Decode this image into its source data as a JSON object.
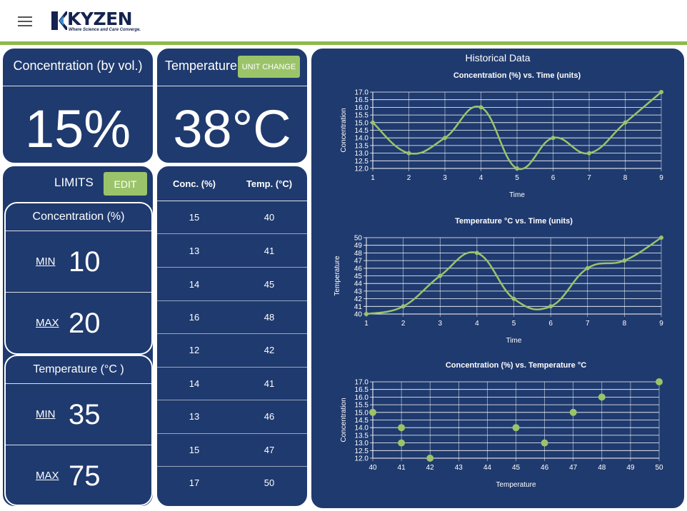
{
  "header": {
    "menu_icon": "hamburger-menu-icon",
    "logo_text": "KYZEN",
    "logo_tagline": "Where Science and Care Converge.",
    "accent_color": "#8db94a"
  },
  "concentration_card": {
    "title": "Concentration (by vol.)",
    "value": "15%"
  },
  "temperature_card": {
    "title": "Temperature",
    "unit_button": "UNIT CHANGE",
    "value": "38°C"
  },
  "limits": {
    "title": "LIMITS",
    "edit_button": "EDIT",
    "concentration": {
      "title": "Concentration (%)",
      "min_label": "MIN",
      "min_value": "10",
      "max_label": "MAX",
      "max_value": "20"
    },
    "temperature": {
      "title": "Temperature (°C )",
      "min_label": "MIN",
      "min_value": "35",
      "max_label": "MAX",
      "max_value": "75"
    }
  },
  "data_table": {
    "headers": [
      "Conc. (%)",
      "Temp. (°C)"
    ],
    "rows": [
      [
        "15",
        "40"
      ],
      [
        "13",
        "41"
      ],
      [
        "14",
        "45"
      ],
      [
        "16",
        "48"
      ],
      [
        "12",
        "42"
      ],
      [
        "14",
        "41"
      ],
      [
        "13",
        "46"
      ],
      [
        "15",
        "47"
      ],
      [
        "17",
        "50"
      ]
    ]
  },
  "historical": {
    "title": "Historical Data"
  },
  "chart_data": [
    {
      "type": "line",
      "title": "Concentration (%) vs. Time (units)",
      "xlabel": "Time",
      "ylabel": "Concentration",
      "x": [
        1,
        2,
        3,
        4,
        5,
        6,
        7,
        8,
        9
      ],
      "y": [
        15,
        13,
        14,
        16,
        12,
        14,
        13,
        15,
        17
      ],
      "ylim": [
        12.0,
        17.0
      ],
      "yticks": [
        "12.0",
        "12.5",
        "13.0",
        "13.5",
        "14.0",
        "14.5",
        "15.0",
        "15.5",
        "16.0",
        "16.5",
        "17.0"
      ],
      "xticks": [
        "1",
        "2",
        "3",
        "4",
        "5",
        "6",
        "7",
        "8",
        "9"
      ],
      "color": "#9bc46a"
    },
    {
      "type": "line",
      "title": "Temperature °C vs. Time (units)",
      "xlabel": "Time",
      "ylabel": "Temperature",
      "x": [
        1,
        2,
        3,
        4,
        5,
        6,
        7,
        8,
        9
      ],
      "y": [
        40,
        41,
        45,
        48,
        42,
        41,
        46,
        47,
        50
      ],
      "ylim": [
        40,
        50
      ],
      "yticks": [
        "40",
        "41",
        "42",
        "43",
        "44",
        "45",
        "46",
        "47",
        "48",
        "49",
        "50"
      ],
      "xticks": [
        "1",
        "2",
        "3",
        "4",
        "5",
        "6",
        "7",
        "8",
        "9"
      ],
      "color": "#9bc46a"
    },
    {
      "type": "scatter",
      "title": "Concentration (%) vs. Temperature °C",
      "xlabel": "Temperature",
      "ylabel": "Concentration",
      "x": [
        40,
        41,
        41,
        42,
        45,
        46,
        47,
        48,
        50
      ],
      "y": [
        15,
        14,
        13,
        12,
        14,
        13,
        15,
        16,
        17
      ],
      "xlim": [
        40,
        50
      ],
      "ylim": [
        12.0,
        17.0
      ],
      "yticks": [
        "12.0",
        "12.5",
        "13.0",
        "13.5",
        "14.0",
        "14.5",
        "15.0",
        "15.5",
        "16.0",
        "16.5",
        "17.0"
      ],
      "xticks": [
        "40",
        "41",
        "42",
        "43",
        "44",
        "45",
        "46",
        "47",
        "48",
        "49",
        "50"
      ],
      "color": "#9bc46a"
    }
  ]
}
